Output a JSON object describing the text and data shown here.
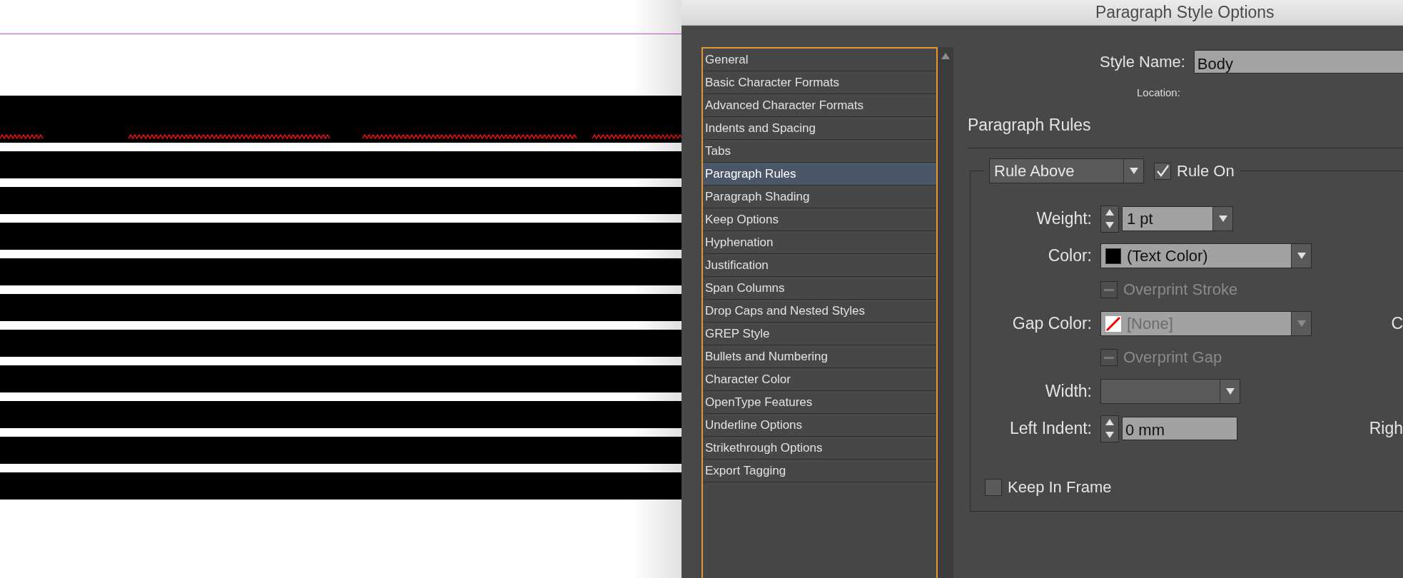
{
  "dialog": {
    "title": "Paragraph Style Options",
    "categories": [
      {
        "label": "General",
        "selected": false
      },
      {
        "label": "Basic Character Formats",
        "selected": false
      },
      {
        "label": "Advanced Character Formats",
        "selected": false
      },
      {
        "label": "Indents and Spacing",
        "selected": false
      },
      {
        "label": "Tabs",
        "selected": false
      },
      {
        "label": "Paragraph Rules",
        "selected": true
      },
      {
        "label": "Paragraph Shading",
        "selected": false
      },
      {
        "label": "Keep Options",
        "selected": false
      },
      {
        "label": "Hyphenation",
        "selected": false
      },
      {
        "label": "Justification",
        "selected": false
      },
      {
        "label": "Span Columns",
        "selected": false
      },
      {
        "label": "Drop Caps and Nested Styles",
        "selected": false
      },
      {
        "label": "GREP Style",
        "selected": false
      },
      {
        "label": "Bullets and Numbering",
        "selected": false
      },
      {
        "label": "Character Color",
        "selected": false
      },
      {
        "label": "OpenType Features",
        "selected": false
      },
      {
        "label": "Underline Options",
        "selected": false
      },
      {
        "label": "Strikethrough Options",
        "selected": false
      },
      {
        "label": "Export Tagging",
        "selected": false
      }
    ],
    "style_name": {
      "label": "Style Name:",
      "value": "Body"
    },
    "location_label": "Location:",
    "section_title": "Paragraph Rules",
    "rule_select": {
      "value": "Rule Above"
    },
    "rule_on": {
      "label": "Rule On",
      "checked": true
    },
    "fields": [
      {
        "kind": "stepper-select",
        "label": "Weight:",
        "value": "1 pt"
      },
      {
        "kind": "color-select",
        "label": "Color:",
        "value": "(Text Color)",
        "color": "#000000",
        "disabled": false
      },
      {
        "kind": "checkbox",
        "label": "Overprint Stroke",
        "disabled": true
      },
      {
        "kind": "color-select",
        "label": "Gap Color:",
        "value": "[None]",
        "swatch_none": true,
        "disabled": true,
        "right_label": "C"
      },
      {
        "kind": "checkbox",
        "label": "Overprint Gap",
        "disabled": true
      },
      {
        "kind": "select",
        "label": "Width:"
      },
      {
        "kind": "stepper-field",
        "label": "Left Indent:",
        "value": "0 mm",
        "right_label": "Righ"
      }
    ],
    "keep_in_frame": {
      "label": "Keep In Frame",
      "checked": false
    }
  }
}
